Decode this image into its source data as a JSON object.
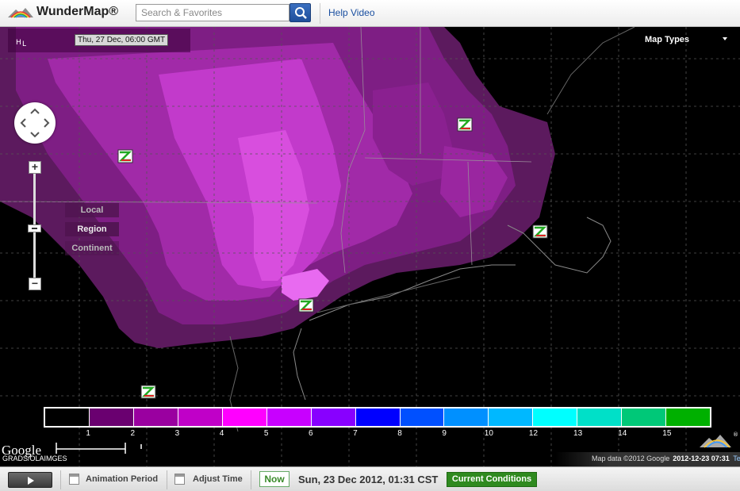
{
  "header": {
    "app_title": "WunderMap®",
    "search_placeholder": "Search & Favorites",
    "help_link": "Help Video"
  },
  "map": {
    "forecast_time": "Thu, 27 Dec, 06:00 GMT",
    "map_types_label": "Map Types",
    "levels": {
      "local": "Local",
      "region": "Region",
      "continent": "Continent"
    },
    "legend": {
      "colors": [
        "#000000",
        "#6a0070",
        "#9a00a0",
        "#c000c8",
        "#ff00ff",
        "#c800ff",
        "#8800ff",
        "#0000ff",
        "#0050ff",
        "#0090ff",
        "#00b8ff",
        "#00ffff",
        "#00e0c8",
        "#00c878",
        "#00b000"
      ],
      "labels": [
        "1",
        "2",
        "3",
        "4",
        "5",
        "6",
        "7",
        "8",
        "9",
        "10",
        "12",
        "13",
        "14",
        "15"
      ]
    },
    "google_label": "Google",
    "attribution_left": "GRADS/OLAIMGES",
    "attribution_right": "Map data ©2012 Google",
    "time_overlay": "2012-12-23 07:31",
    "terms_label": "Terms of Use"
  },
  "footer": {
    "animation_period_label": "Animation Period",
    "adjust_time_label": "Adjust Time",
    "now_label": "Now",
    "current_time": "Sun, 23 Dec 2012, 01:31 CST",
    "current_conditions_label": "Current Conditions"
  },
  "accent_colors": {
    "link": "#1a4fa0",
    "search_button": "#1e4e9a",
    "now_green": "#3a8a2a",
    "current_conditions_bg": "#2f8a1f"
  }
}
